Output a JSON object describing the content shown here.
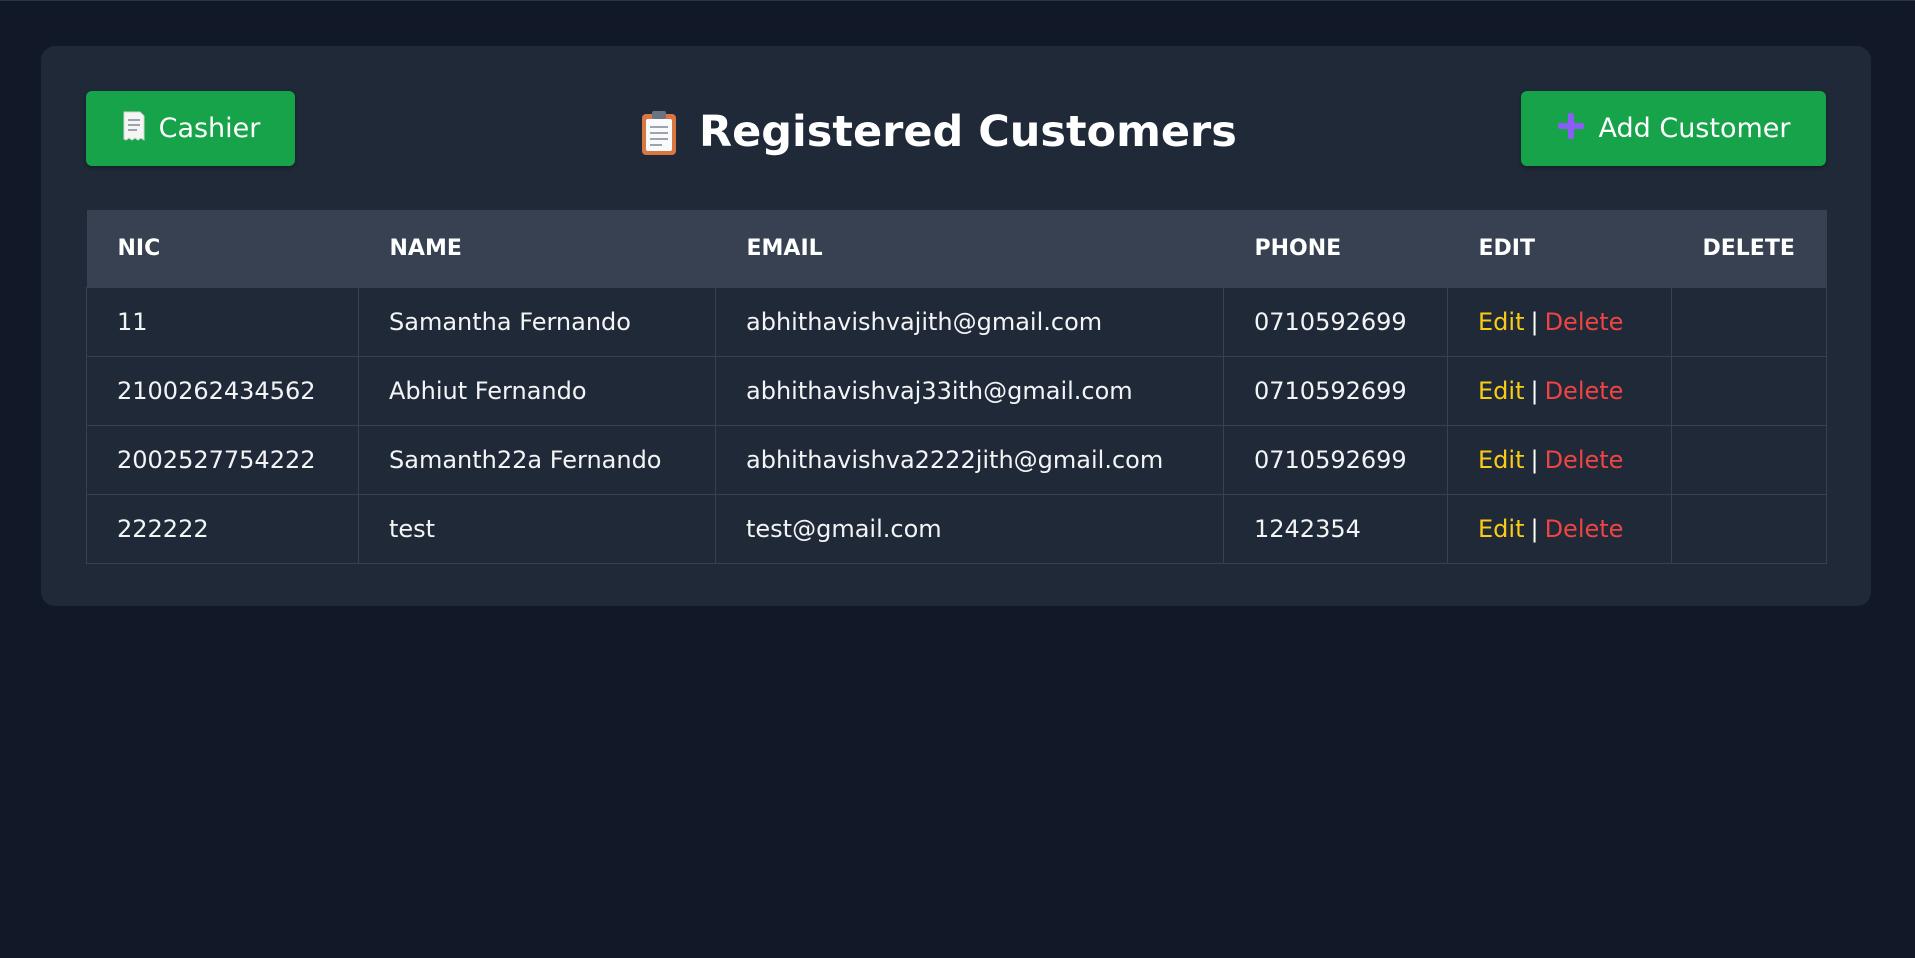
{
  "header": {
    "cashier_button": {
      "icon": "receipt-icon",
      "label": "Cashier"
    },
    "title": "Registered Customers",
    "title_icon": "clipboard-icon",
    "add_button": {
      "icon": "plus-icon",
      "label": "Add Customer"
    }
  },
  "table": {
    "columns": [
      "NIC",
      "NAME",
      "EMAIL",
      "PHONE",
      "EDIT",
      "DELETE"
    ],
    "rows": [
      {
        "nic": "11",
        "name": "Samantha Fernando",
        "email": "abhithavishvajith@gmail.com",
        "phone": "0710592699",
        "edit": "Edit",
        "sep": "|",
        "delete": "Delete"
      },
      {
        "nic": "2100262434562",
        "name": "Abhiut Fernando",
        "email": "abhithavishvaj33ith@gmail.com",
        "phone": "0710592699",
        "edit": "Edit",
        "sep": "|",
        "delete": "Delete"
      },
      {
        "nic": "2002527754222",
        "name": "Samanth22a Fernando",
        "email": "abhithavishva2222jith@gmail.com",
        "phone": "0710592699",
        "edit": "Edit",
        "sep": "|",
        "delete": "Delete"
      },
      {
        "nic": "222222",
        "name": "test",
        "email": "test@gmail.com",
        "phone": "1242354",
        "edit": "Edit",
        "sep": "|",
        "delete": "Delete"
      }
    ]
  },
  "colors": {
    "background": "#111827",
    "card": "#1f2937",
    "header_row": "#374151",
    "button": "#16a34a",
    "edit_link": "#facc15",
    "delete_link": "#ef4444"
  }
}
